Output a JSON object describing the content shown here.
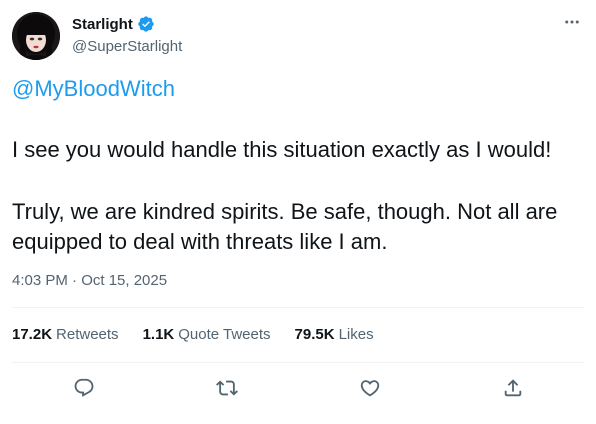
{
  "author": {
    "display_name": "Starlight",
    "handle": "@SuperStarlight",
    "verified": true
  },
  "tweet": {
    "mention": "@MyBloodWitch",
    "paragraphs": [
      "I see you would handle this situation exactly as I would!",
      "Truly, we are kindred spirits. Be safe, though. Not all are equipped to deal with threats like I am."
    ],
    "timestamp": "4:03 PM · Oct 15, 2025"
  },
  "stats": [
    {
      "count": "17.2K",
      "label": "Retweets"
    },
    {
      "count": "1.1K",
      "label": "Quote Tweets"
    },
    {
      "count": "79.5K",
      "label": "Likes"
    }
  ],
  "colors": {
    "accent": "#1d9bf0",
    "secondary_text": "#536471",
    "divider": "#eff3f4"
  },
  "icons": {
    "verified": "verified-badge-icon",
    "more": "more-horizontal-icon",
    "reply": "reply-icon",
    "retweet": "retweet-icon",
    "like": "heart-icon",
    "share": "share-icon"
  }
}
